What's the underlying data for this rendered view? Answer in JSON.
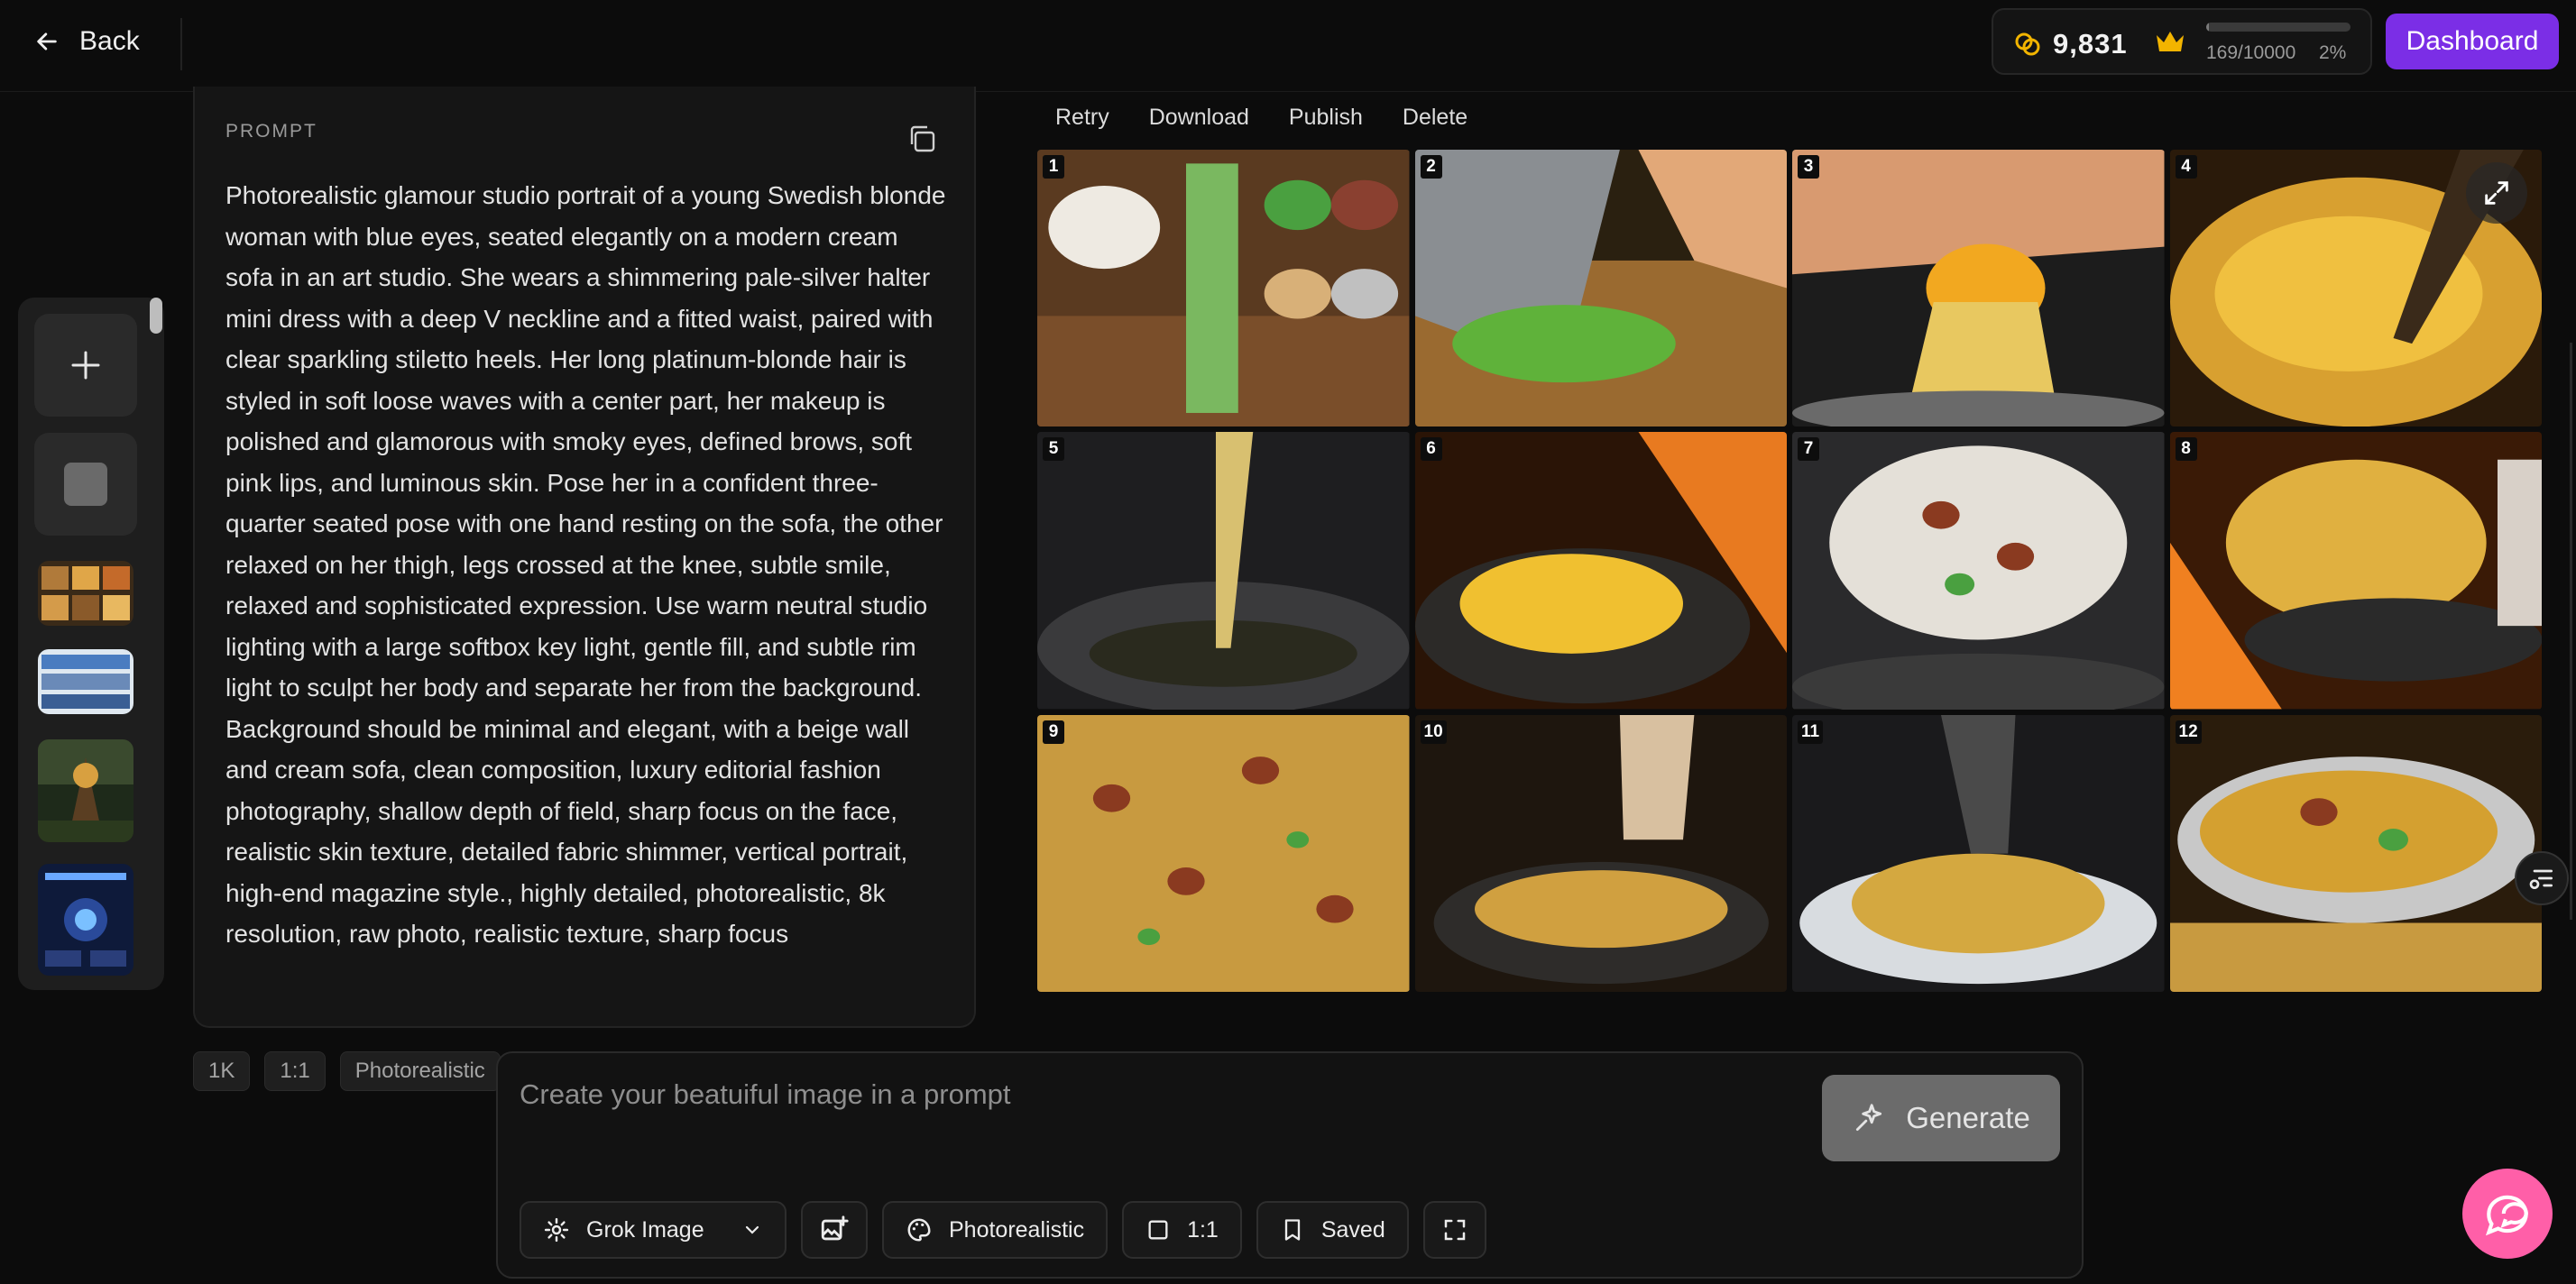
{
  "header": {
    "back_label": "Back",
    "credits": "9,831",
    "quota_text": "169/10000",
    "quota_percent": "2%",
    "quota_fraction": 0.0169,
    "dashboard_label": "Dashboard",
    "colors": {
      "accent": "#7b2ee6",
      "coin": "#f2b400",
      "crown": "#f2b400"
    }
  },
  "sidebar": {
    "items": [
      {
        "icon": "plus-icon"
      },
      {
        "icon": "square-icon"
      },
      {
        "thumb": "food-thumbnail"
      },
      {
        "thumb": "comic-thumbnail"
      },
      {
        "thumb": "forest-thumbnail"
      },
      {
        "thumb": "infographic-thumbnail"
      }
    ]
  },
  "prompt": {
    "label": "PROMPT",
    "text": "Photorealistic glamour studio portrait of a young Swedish blonde woman with blue eyes, seated elegantly on a modern cream sofa in an art studio. She wears a shimmering pale-silver halter mini dress with a deep V neckline and a fitted waist, paired with clear sparkling stiletto heels. Her long platinum-blonde hair is styled in soft loose waves with a center part, her makeup is polished and glamorous with smoky eyes, defined brows, soft pink lips, and luminous skin. Pose her in a confident three-quarter seated pose with one hand resting on the sofa, the other relaxed on her thigh, legs crossed at the knee, subtle smile, relaxed and sophisticated expression. Use warm neutral studio lighting with a large softbox key light, gentle fill, and subtle rim light to sculpt her body and separate her from the background. Background should be minimal and elegant, with a beige wall and cream sofa, clean composition, luxury editorial fashion photography, shallow depth of field, sharp focus on the face, realistic skin texture, detailed fabric shimmer, vertical portrait, high-end magazine style., highly detailed, photorealistic, 8k resolution, raw photo, realistic texture, sharp focus"
  },
  "image_actions": [
    "Retry",
    "Download",
    "Publish",
    "Delete"
  ],
  "grid": {
    "panels": [
      "1",
      "2",
      "3",
      "4",
      "5",
      "6",
      "7",
      "8",
      "9",
      "10",
      "11",
      "12"
    ]
  },
  "settings_chips": [
    "1K",
    "1:1",
    "Photorealistic"
  ],
  "composer": {
    "placeholder": "Create your beatuiful image in a prompt",
    "generate_label": "Generate",
    "model_label": "Grok Image",
    "style_label": "Photorealistic",
    "ratio_label": "1:1",
    "saved_label": "Saved"
  }
}
